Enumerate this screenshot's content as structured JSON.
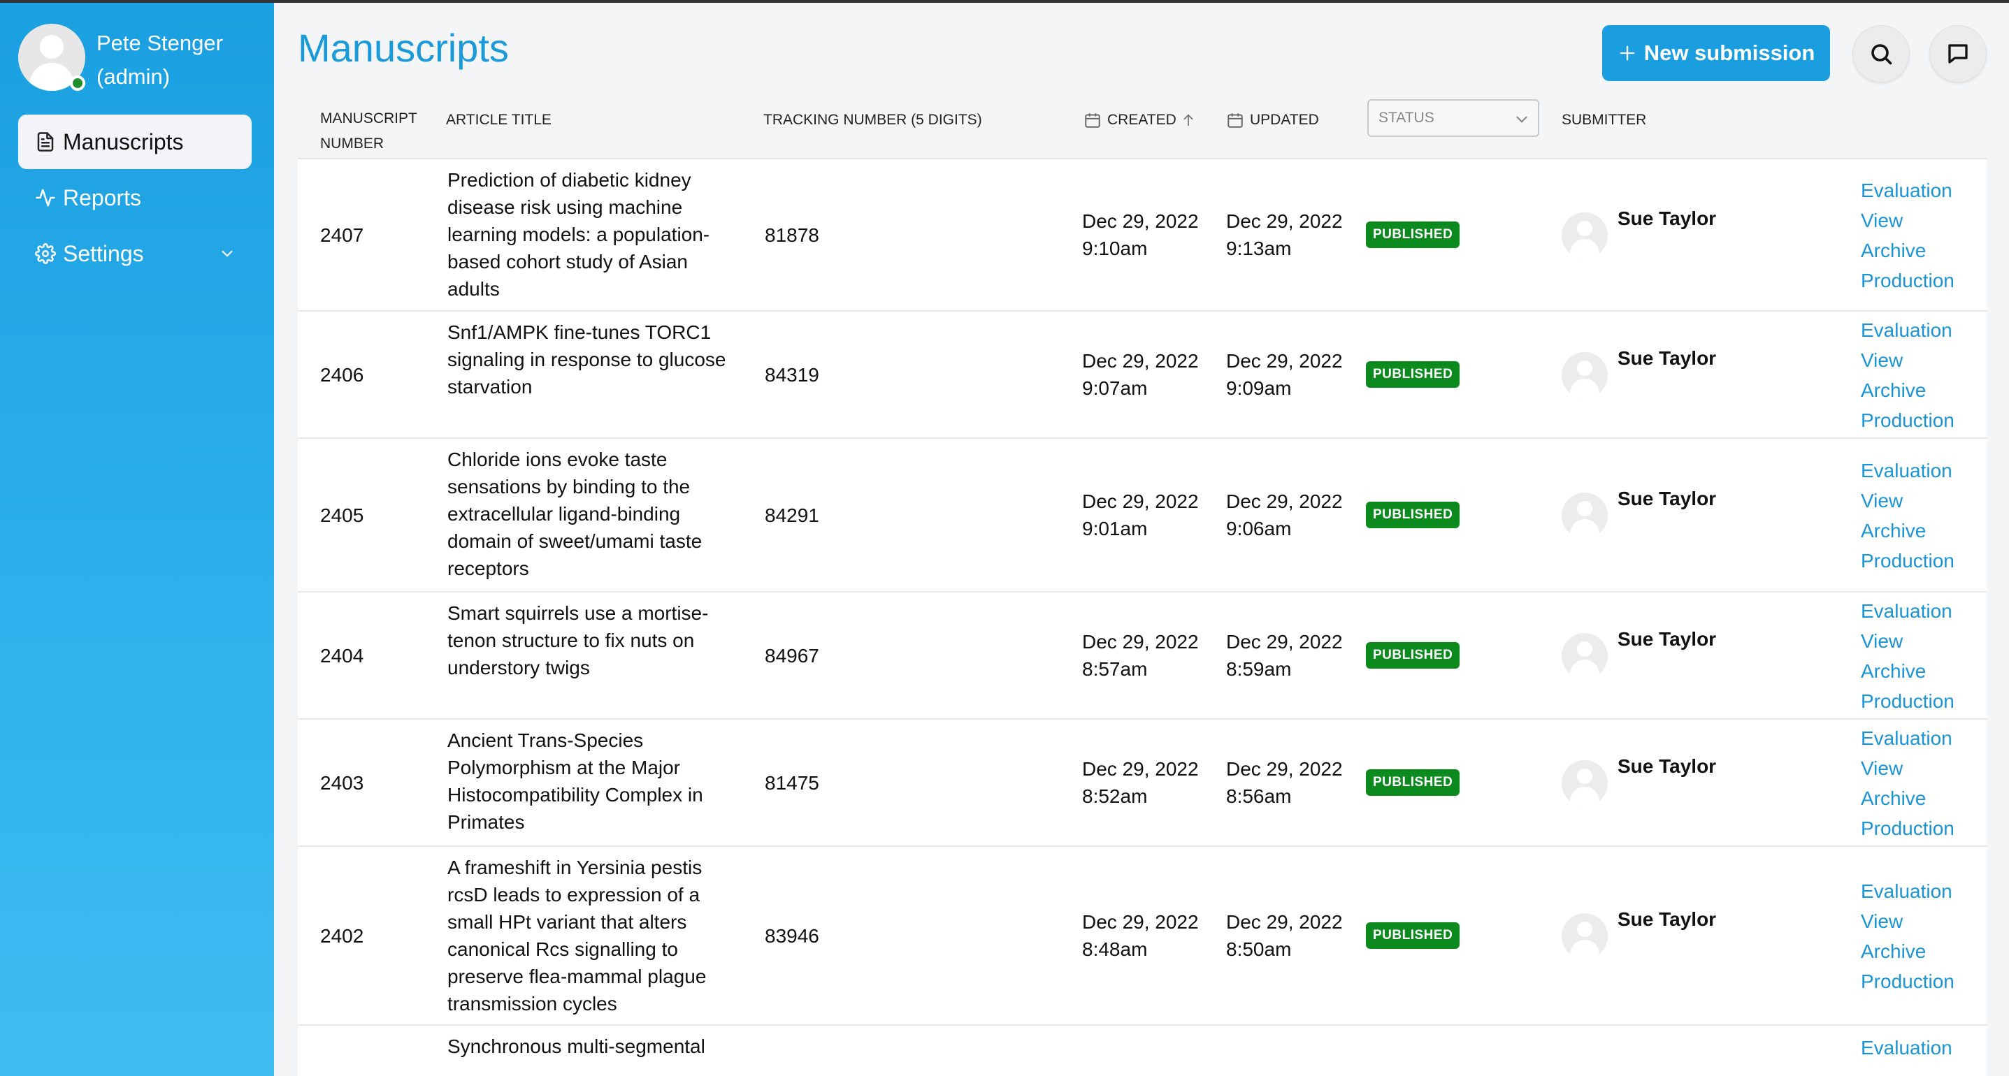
{
  "user": {
    "name": "Pete Stenger",
    "role": "(admin)"
  },
  "nav": [
    {
      "label": "Manuscripts",
      "icon": "document-icon",
      "active": true
    },
    {
      "label": "Reports",
      "icon": "activity-icon"
    },
    {
      "label": "Settings",
      "icon": "gear-icon",
      "expandable": true
    }
  ],
  "header": {
    "title": "Manuscripts",
    "new_label": "New submission"
  },
  "table": {
    "columns": {
      "number_1": "Manuscript",
      "number_2": "Number",
      "title": "Article Title",
      "tracking": "Tracking Number (5 digits)",
      "created": "Created",
      "updated": "Updated",
      "status": "Status",
      "submitter": "Submitter"
    },
    "actions": [
      "Evaluation",
      "View",
      "Archive",
      "Production"
    ],
    "rows": [
      {
        "number": "2407",
        "title": "Prediction of diabetic kidney disease risk using machine learning models: a population-based cohort study of Asian adults",
        "tracking": "81878",
        "created_date": "Dec 29, 2022",
        "created_time": "9:10am",
        "updated_date": "Dec 29, 2022",
        "updated_time": "9:13am",
        "status": "PUBLISHED",
        "submitter": "Sue Taylor"
      },
      {
        "number": "2406",
        "title": "Snf1/AMPK fine-tunes TORC1 signaling in response to glucose starvation",
        "tracking": "84319",
        "created_date": "Dec 29, 2022",
        "created_time": "9:07am",
        "updated_date": "Dec 29, 2022",
        "updated_time": "9:09am",
        "status": "PUBLISHED",
        "submitter": "Sue Taylor"
      },
      {
        "number": "2405",
        "title": "Chloride ions evoke taste sensations by binding to the extracellular ligand-binding domain of sweet/umami taste receptors",
        "tracking": "84291",
        "created_date": "Dec 29, 2022",
        "created_time": "9:01am",
        "updated_date": "Dec 29, 2022",
        "updated_time": "9:06am",
        "status": "PUBLISHED",
        "submitter": "Sue Taylor"
      },
      {
        "number": "2404",
        "title": "Smart squirrels use a mortise-tenon structure to fix nuts on understory twigs",
        "tracking": "84967",
        "created_date": "Dec 29, 2022",
        "created_time": "8:57am",
        "updated_date": "Dec 29, 2022",
        "updated_time": "8:59am",
        "status": "PUBLISHED",
        "submitter": "Sue Taylor"
      },
      {
        "number": "2403",
        "title": "Ancient Trans-Species Polymorphism at the Major Histocompatibility Complex in Primates",
        "tracking": "81475",
        "created_date": "Dec 29, 2022",
        "created_time": "8:52am",
        "updated_date": "Dec 29, 2022",
        "updated_time": "8:56am",
        "status": "PUBLISHED",
        "submitter": "Sue Taylor"
      },
      {
        "number": "2402",
        "title": "A frameshift in Yersinia pestis rcsD leads to expression of a small HPt variant that alters canonical Rcs signalling to preserve flea-mammal plague transmission cycles",
        "tracking": "83946",
        "created_date": "Dec 29, 2022",
        "created_time": "8:48am",
        "updated_date": "Dec 29, 2022",
        "updated_time": "8:50am",
        "status": "PUBLISHED",
        "submitter": "Sue Taylor"
      },
      {
        "number": "",
        "title": "Synchronous multi-segmental",
        "tracking": "",
        "created_date": "",
        "created_time": "",
        "updated_date": "",
        "updated_time": "",
        "status": "",
        "submitter": ""
      }
    ]
  }
}
